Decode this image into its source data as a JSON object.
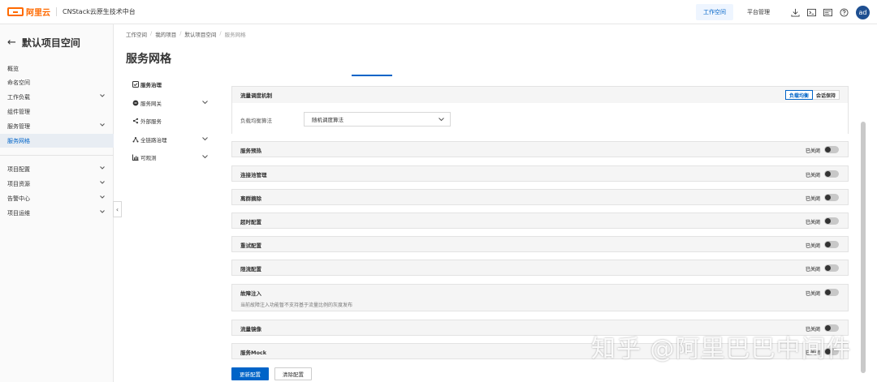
{
  "header": {
    "brand": "阿里云",
    "product": "CNStack云原生技术中台",
    "tabs": [
      {
        "label": "工作空间",
        "active": true
      },
      {
        "label": "平台管理",
        "active": false
      }
    ],
    "icons": [
      "download-icon",
      "terminal-icon",
      "console-icon",
      "help-icon"
    ],
    "avatar": "ad"
  },
  "sidebar": {
    "title": "默认项目空间",
    "items": [
      {
        "label": "概览",
        "chevron": false,
        "active": false
      },
      {
        "label": "命名空间",
        "chevron": false,
        "active": false
      },
      {
        "label": "工作负载",
        "chevron": true,
        "active": false
      },
      {
        "label": "组件管理",
        "chevron": false,
        "active": false
      },
      {
        "label": "服务管理",
        "chevron": true,
        "active": false
      },
      {
        "label": "服务网格",
        "chevron": false,
        "active": true
      }
    ],
    "items2": [
      {
        "label": "项目配置",
        "chevron": true
      },
      {
        "label": "项目资源",
        "chevron": true
      },
      {
        "label": "告警中心",
        "chevron": true
      },
      {
        "label": "项目运维",
        "chevron": true
      }
    ]
  },
  "breadcrumb": [
    "工作空间",
    "我的项目",
    "默认项目空间",
    "服务网格"
  ],
  "page_title": "服务网格",
  "submenu": [
    {
      "label": "服务治理",
      "icon": "governance-icon",
      "chevron": false,
      "active": true
    },
    {
      "label": "服务网关",
      "icon": "gateway-icon",
      "chevron": true,
      "active": false
    },
    {
      "label": "外部服务",
      "icon": "share-icon",
      "chevron": false,
      "active": false
    },
    {
      "label": "全链路治理",
      "icon": "link-icon",
      "chevron": true,
      "active": false
    },
    {
      "label": "可观测",
      "icon": "chart-icon",
      "chevron": true,
      "active": false
    }
  ],
  "traffic": {
    "title": "流量调度机制",
    "segments": [
      {
        "label": "负载均衡",
        "active": true
      },
      {
        "label": "会话保持",
        "active": false
      }
    ],
    "field_label": "负载均衡算法",
    "select_value": "随机调度算法"
  },
  "features": [
    {
      "name": "服务预热",
      "status": "已关闭"
    },
    {
      "name": "连接池管理",
      "status": "已关闭"
    },
    {
      "name": "离群摘除",
      "status": "已关闭"
    },
    {
      "name": "超时配置",
      "status": "已关闭"
    },
    {
      "name": "重试配置",
      "status": "已关闭"
    },
    {
      "name": "限流配置",
      "status": "已关闭"
    },
    {
      "name": "故障注入",
      "status": "已关闭",
      "desc": "当前故障注入功能暂不支持基于流量比例的灰度发布"
    },
    {
      "name": "流量镜像",
      "status": "已关闭"
    },
    {
      "name": "服务Mock",
      "status": "已关闭"
    }
  ],
  "buttons": {
    "update": "更新配置",
    "clear": "清除配置"
  },
  "watermark": "知乎 @阿里巴巴中间件",
  "colors": {
    "accent": "#0064c8",
    "brand": "#ff6a00"
  }
}
